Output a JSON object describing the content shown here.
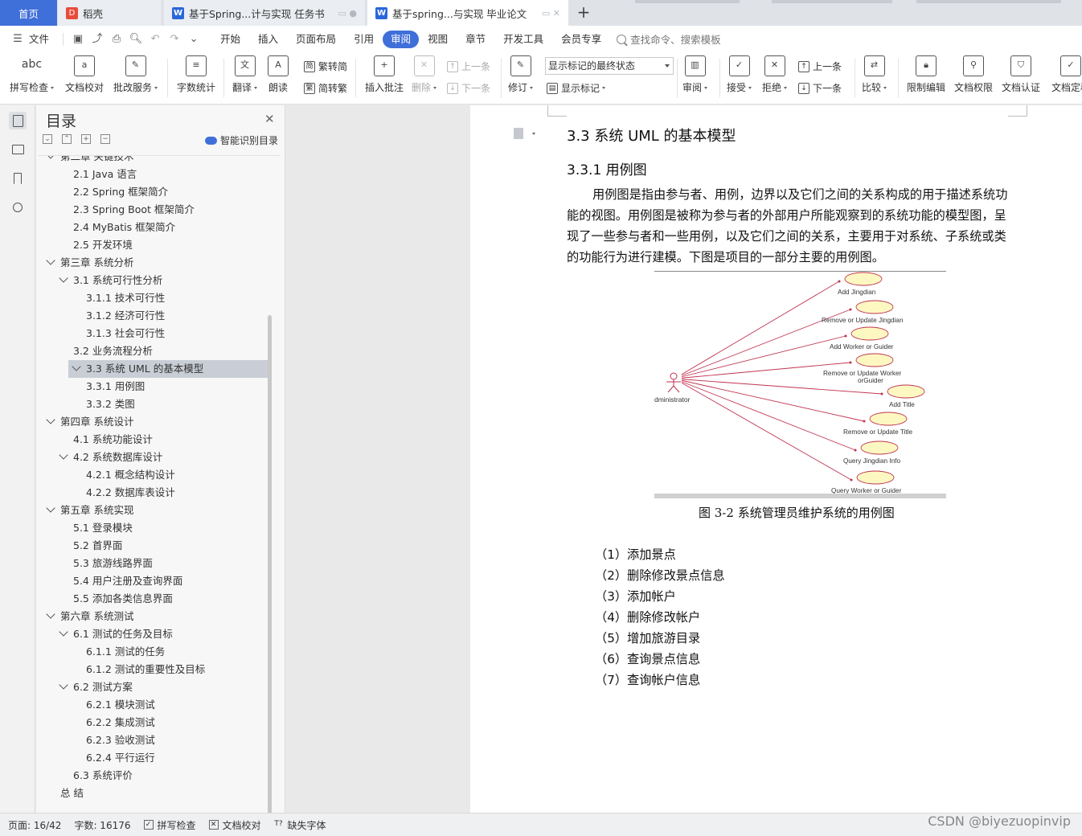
{
  "tabs": {
    "home": "首页",
    "items": [
      {
        "icon": "daoke-icon",
        "label": "稻壳"
      },
      {
        "icon": "word-doc-icon",
        "label": "基于Spring...计与实现 任务书"
      },
      {
        "icon": "word-doc-icon",
        "label": "基于spring...与实现 毕业论文"
      }
    ],
    "add": "+"
  },
  "menu": {
    "file": "文件",
    "items": [
      "开始",
      "插入",
      "页面布局",
      "引用",
      "审阅",
      "视图",
      "章节",
      "开发工具",
      "会员专享"
    ],
    "active": "审阅",
    "search": "查找命令、搜索模板"
  },
  "ribbon": {
    "spell_check": "拼写检查",
    "spell_glyph": "abc",
    "doc_proof": "文档校对",
    "batch_service": "批改服务",
    "word_count": "字数统计",
    "translate": "翻译",
    "read_aloud": "朗读",
    "trad_to_simp": "繁转简",
    "simp_to_trad": "简转繁",
    "insert_comment": "插入批注",
    "delete": "删除",
    "prev": "上一条",
    "next": "下一条",
    "revise": "修订",
    "markup_state": "显示标记的最终状态",
    "show_markup": "显示标记",
    "review": "审阅",
    "accept": "接受",
    "reject": "拒绝",
    "prev2": "上一条",
    "next2": "下一条",
    "compare": "比较",
    "restrict_edit": "限制编辑",
    "doc_permission": "文档权限",
    "doc_cert": "文档认证",
    "doc_final": "文档定稿"
  },
  "toc": {
    "title": "目录",
    "smart": "智能识别目录",
    "items": [
      {
        "label": "第二章  关键技术",
        "level": 0,
        "expanded": true
      },
      {
        "label": "2.1 Java 语言",
        "level": 1
      },
      {
        "label": "2.2 Spring 框架简介",
        "level": 1
      },
      {
        "label": "2.3 Spring Boot 框架简介",
        "level": 1
      },
      {
        "label": "2.4 MyBatis  框架简介",
        "level": 1
      },
      {
        "label": "2.5  开发环境",
        "level": 1
      },
      {
        "label": "第三章  系统分析",
        "level": 0,
        "expanded": true
      },
      {
        "label": "3.1  系统可行性分析",
        "level": 1,
        "expanded": true
      },
      {
        "label": "3.1.1  技术可行性",
        "level": 2
      },
      {
        "label": "3.1.2  经济可行性",
        "level": 2
      },
      {
        "label": "3.1.3  社会可行性",
        "level": 2
      },
      {
        "label": "3.2  业务流程分析",
        "level": 1
      },
      {
        "label": "3.3  系统 UML 的基本模型",
        "level": 1,
        "expanded": true,
        "selected": true
      },
      {
        "label": "3.3.1  用例图",
        "level": 2
      },
      {
        "label": "3.3.2  类图",
        "level": 2
      },
      {
        "label": "第四章  系统设计",
        "level": 0,
        "expanded": true
      },
      {
        "label": "4.1  系统功能设计",
        "level": 1
      },
      {
        "label": "4.2  系统数据库设计",
        "level": 1,
        "expanded": true
      },
      {
        "label": "4.2.1  概念结构设计",
        "level": 2
      },
      {
        "label": "4.2.2  数据库表设计",
        "level": 2
      },
      {
        "label": "第五章  系统实现",
        "level": 0,
        "expanded": true
      },
      {
        "label": "5.1 登录模块",
        "level": 1
      },
      {
        "label": "5.2  首界面",
        "level": 1
      },
      {
        "label": "5.3  旅游线路界面",
        "level": 1
      },
      {
        "label": "5.4  用户注册及查询界面",
        "level": 1
      },
      {
        "label": "5.5  添加各类信息界面",
        "level": 1
      },
      {
        "label": "第六章  系统测试",
        "level": 0,
        "expanded": true
      },
      {
        "label": "6.1 测试的任务及目标",
        "level": 1,
        "expanded": true
      },
      {
        "label": "6.1.1 测试的任务",
        "level": 2
      },
      {
        "label": "6.1.2 测试的重要性及目标",
        "level": 2
      },
      {
        "label": "6.2 测试方案",
        "level": 1,
        "expanded": true
      },
      {
        "label": "6.2.1 模块测试",
        "level": 2
      },
      {
        "label": "6.2.2 集成测试",
        "level": 2
      },
      {
        "label": "6.2.3 验收测试",
        "level": 2
      },
      {
        "label": "6.2.4 平行运行",
        "level": 2
      },
      {
        "label": "6.3 系统评价",
        "level": 1
      },
      {
        "label": "总    结",
        "level": 0
      }
    ]
  },
  "doc": {
    "h1": "3.3  系统 UML 的基本模型",
    "h2": "3.3.1  用例图",
    "paragraph": "用例图是指由参与者、用例，边界以及它们之间的关系构成的用于描述系统功能的视图。用例图是被称为参与者的外部用户所能观察到的系统功能的模型图，呈现了一些参与者和一些用例，以及它们之间的关系，主要用于对系统、子系统或类的功能行为进行建模。下图是项目的一部分主要的用例图。",
    "figure": {
      "actor": "dministrator",
      "use_cases": [
        "Add  Jingdian",
        "Remove or Update Jingdian",
        "Add Worker or Guider",
        "Remove or Update Worker orGuider",
        "Add Title",
        "Remove or Update Title",
        "Query Jingdian Info",
        "Query Worker or Guider"
      ]
    },
    "caption": "图 3-2 系统管理员维护系统的用例图",
    "list": [
      "（1）添加景点",
      "（2）删除修改景点信息",
      "（3）添加帐户",
      "（4）删除修改帐户",
      "（5）增加旅游目录",
      "（6）查询景点信息",
      "（7）查询帐户信息"
    ]
  },
  "status": {
    "page": "页面: 16/42",
    "words": "字数: 16176",
    "spell": "拼写检查",
    "proof": "文档校对",
    "missing_font": "缺失字体"
  },
  "watermark": "CSDN @biyezuopinvip",
  "colors": {
    "accent": "#3f6fd8",
    "uml_line": "#c0334f",
    "uml_ellipse": "#fdf8c2"
  }
}
